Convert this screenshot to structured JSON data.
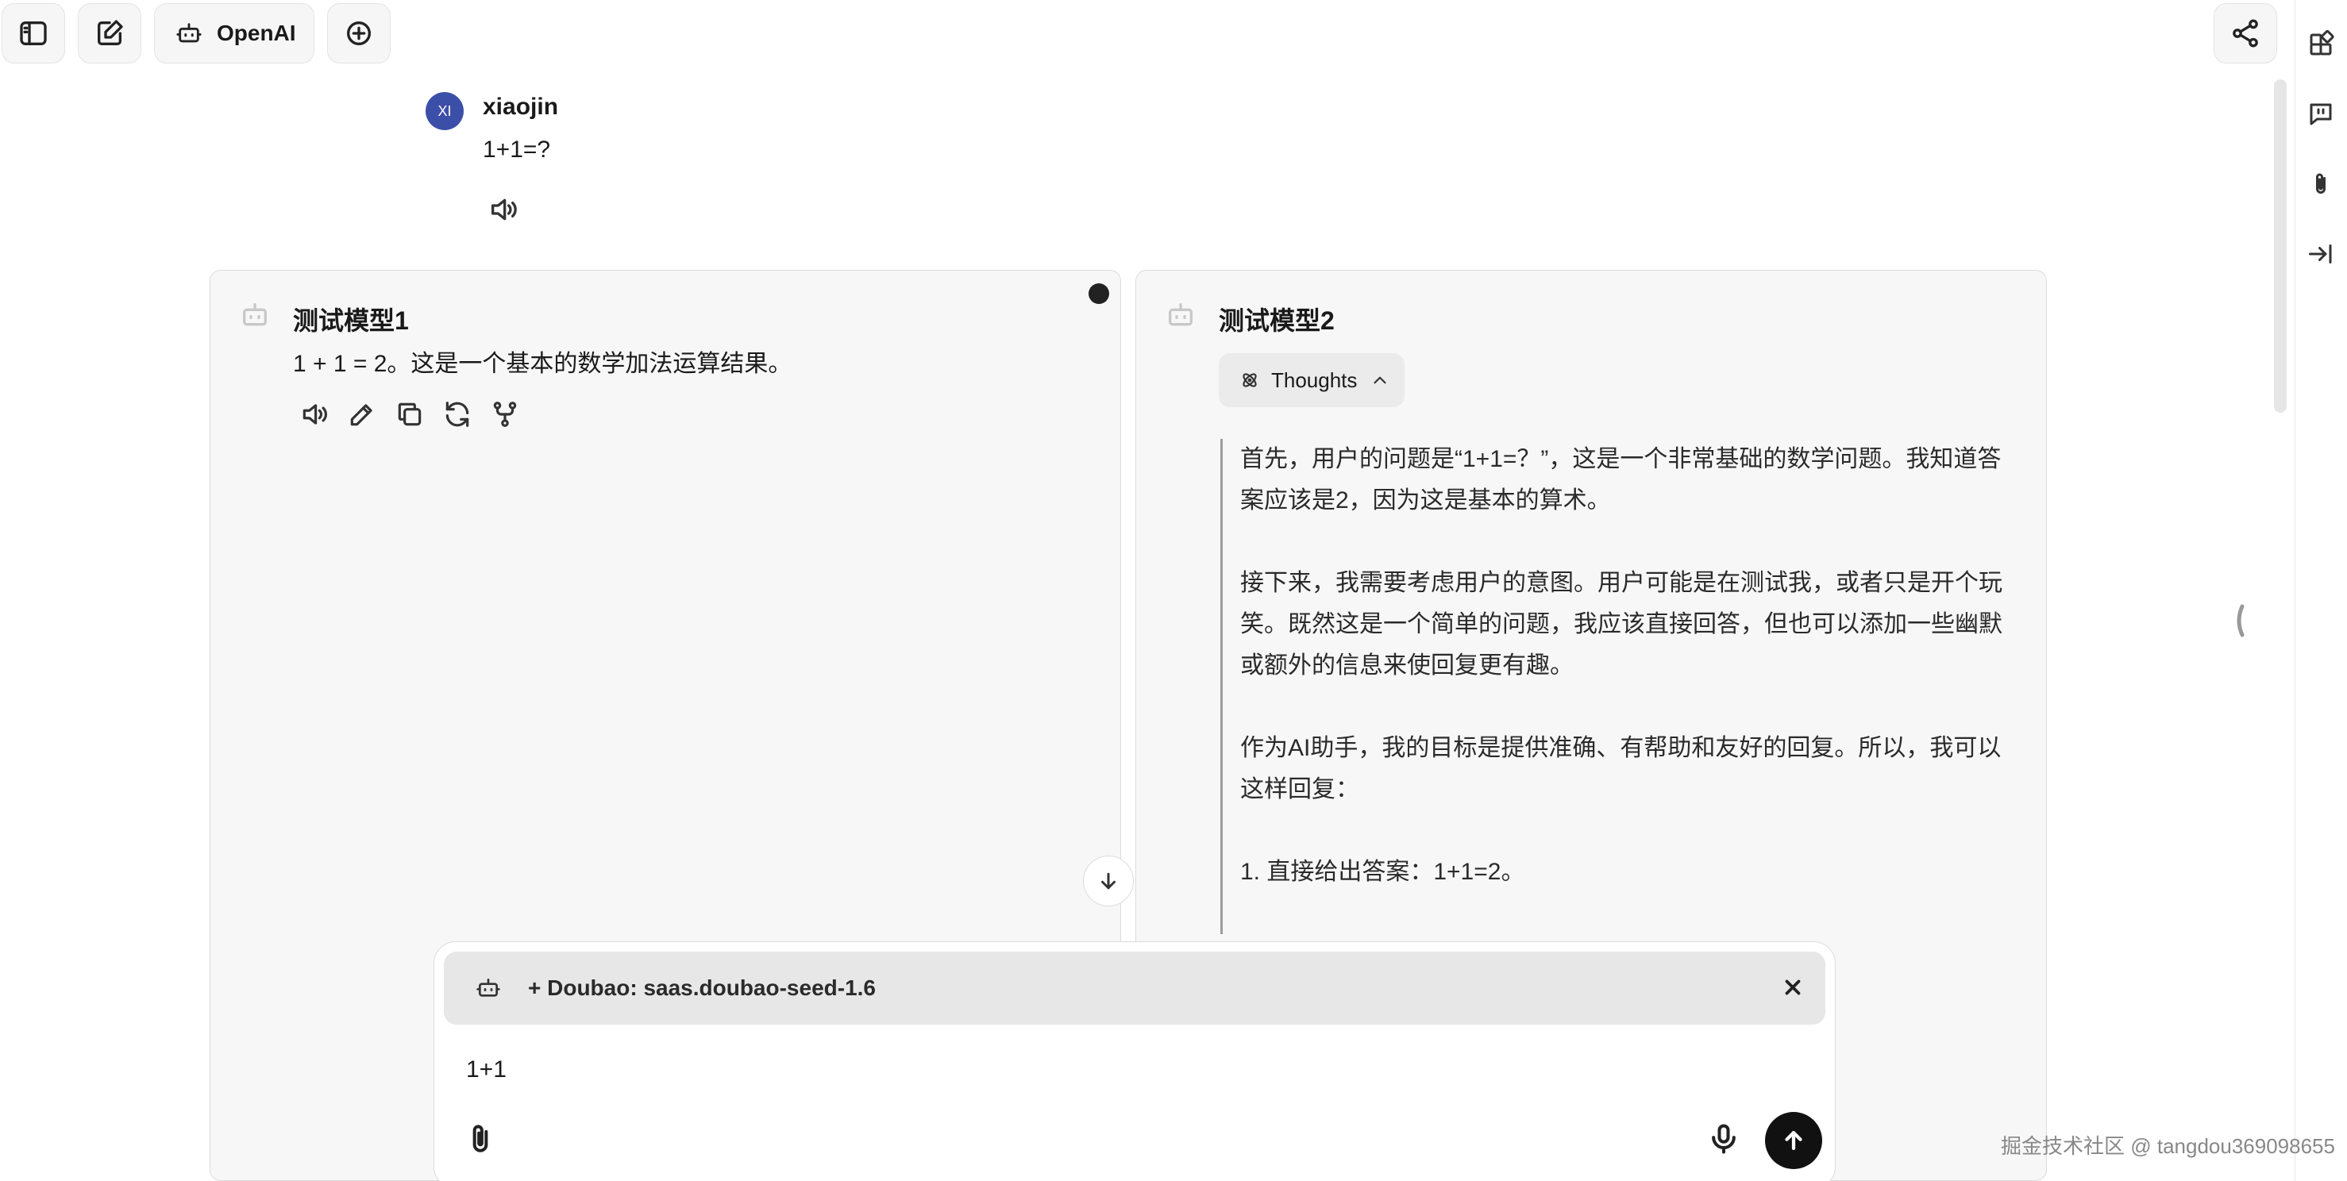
{
  "header": {
    "provider_label": "OpenAI"
  },
  "user_message": {
    "avatar_initials": "XI",
    "username": "xiaojin",
    "text": "1+1=?"
  },
  "panels": [
    {
      "title": "测试模型1",
      "answer": "1 + 1 = 2。这是一个基本的数学加法运算结果。"
    },
    {
      "title": "测试模型2",
      "thoughts_label": "Thoughts",
      "thoughts_paragraphs": [
        "首先，用户的问题是“1+1=？”，这是一个非常基础的数学问题。我知道答案应该是2，因为这是基本的算术。",
        "接下来，我需要考虑用户的意图。用户可能是在测试我，或者只是开个玩笑。既然这是一个简单的问题，我应该直接回答，但也可以添加一些幽默或额外的信息来使回复更有趣。",
        "作为AI助手，我的目标是提供准确、有帮助和友好的回复。所以，我可以这样回复：",
        "1. 直接给出答案：1+1=2。"
      ]
    }
  ],
  "composer": {
    "model_chip_label": "+ Doubao: saas.doubao-seed-1.6",
    "input_value": "1+1"
  },
  "watermark": "掘金技术社区 @ tangdou369098655",
  "colors": {
    "avatar_bg": "#3c4fa8",
    "send_bg": "#111111",
    "panel_bg": "#f7f7f7"
  },
  "icons": {
    "sidebar_toggle": "sidebar-icon",
    "new_chat": "edit-icon",
    "add_model": "plus-circle-icon",
    "share": "share-icon",
    "speaker": "speaker-icon"
  }
}
